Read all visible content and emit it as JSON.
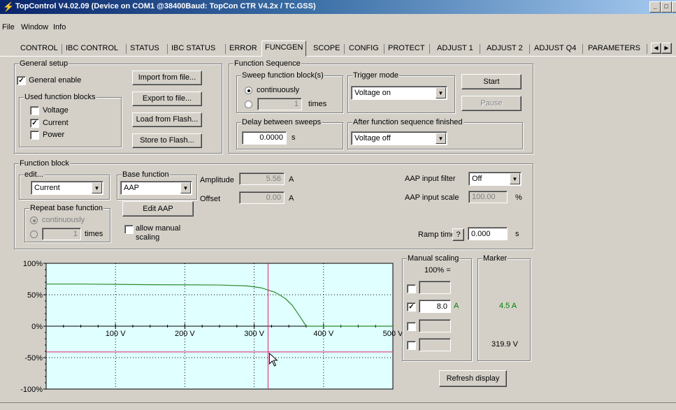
{
  "window": {
    "title": "TopControl V4.02.09 (Device on COM1 @38400Baud: TopCon CTR V4.2x / TC.GSS)"
  },
  "menu": [
    "File",
    "Window",
    "Info"
  ],
  "tabs": [
    "CONTROL",
    "IBC CONTROL",
    "STATUS",
    "IBC STATUS",
    "ERROR",
    "FUNCGEN",
    "SCOPE",
    "CONFIG",
    "PROTECT",
    "ADJUST 1",
    "ADJUST 2",
    "ADJUST Q4",
    "PARAMETERS"
  ],
  "active_tab": "FUNCGEN",
  "general_setup": {
    "title": "General setup",
    "general_enable": "General enable",
    "used_blocks_title": "Used function blocks",
    "blocks": [
      "Voltage",
      "Current",
      "Power"
    ],
    "blocks_checked": [
      false,
      true,
      false
    ],
    "buttons": [
      "Import from file...",
      "Export to file...",
      "Load from Flash...",
      "Store to Flash..."
    ]
  },
  "function_sequence": {
    "title": "Function Sequence",
    "sweep_title": "Sweep function block(s)",
    "continuously": "continuously",
    "times_value": "1",
    "times": "times",
    "trigger_title": "Trigger mode",
    "trigger_value": "Voltage on",
    "start": "Start",
    "pause": "Pause",
    "delay_title": "Delay between sweeps",
    "delay_value": "0.0000",
    "delay_unit": "s",
    "after_title": "After function sequence finished",
    "after_value": "Voltage off"
  },
  "function_block": {
    "title": "Function block",
    "edit_title": "edit...",
    "edit_value": "Current",
    "repeat_title": "Repeat base function",
    "repeat_continuously": "continuously",
    "repeat_times_value": "1",
    "repeat_times": "times",
    "base_title": "Base function",
    "base_value": "AAP",
    "edit_aap": "Edit AAP",
    "allow_manual": "allow manual",
    "scaling": "scaling",
    "amplitude_label": "Amplitude",
    "amplitude_value": "5.56",
    "amplitude_unit": "A",
    "offset_label": "Offset",
    "offset_value": "0.00",
    "offset_unit": "A",
    "aap_filter_label": "AAP input filter",
    "aap_filter_value": "Off",
    "aap_scale_label": "AAP input scale",
    "aap_scale_value": "100.00",
    "aap_scale_unit": "%",
    "ramp_label": "Ramp time",
    "ramp_help": "?",
    "ramp_value": "0.000",
    "ramp_unit": "s"
  },
  "manual_scaling": {
    "title": "Manual scaling",
    "hundred": "100% =",
    "value": "8.0",
    "unit": "A"
  },
  "marker": {
    "title": "Marker",
    "current": "4.5 A",
    "voltage": "319.9 V"
  },
  "refresh": "Refresh display",
  "chart_data": {
    "type": "line",
    "x_ticks": [
      "100 V",
      "200 V",
      "300 V",
      "400 V",
      "500 V"
    ],
    "y_ticks": [
      "100%",
      "50%",
      "0%",
      "-50%",
      "-100%"
    ],
    "xlim": [
      0,
      500
    ],
    "ylim": [
      -100,
      100
    ],
    "series": [
      {
        "color": "#2e8b2e",
        "x": [
          0,
          50,
          100,
          150,
          200,
          250,
          290,
          310,
          330,
          345,
          355,
          365,
          375,
          500
        ],
        "y": [
          67,
          67,
          66.5,
          66,
          65.8,
          65.5,
          64,
          61,
          54,
          44,
          33,
          17,
          0,
          0
        ]
      }
    ],
    "marker_x": 320,
    "marker_y": -41,
    "background": "#e0ffff",
    "marker_color": "#e0207a",
    "grid": true
  }
}
